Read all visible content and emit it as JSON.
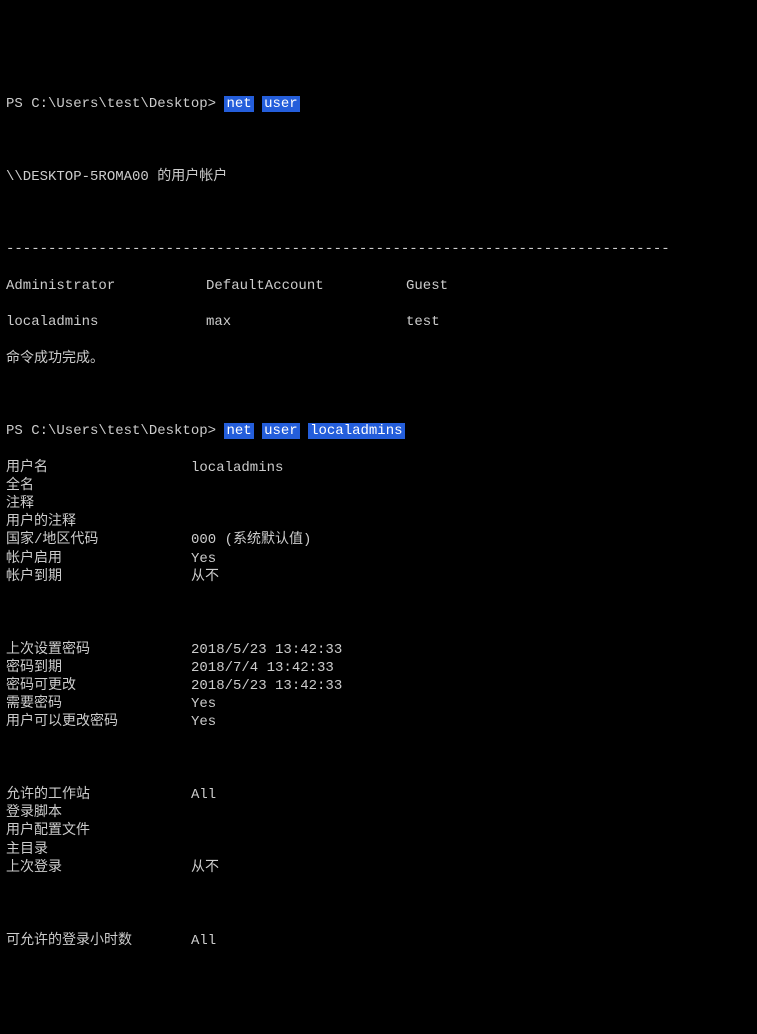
{
  "prompt1": {
    "path": "PS C:\\Users\\test\\Desktop>",
    "cmd_parts": [
      "net",
      "user"
    ]
  },
  "header1": "\\\\DESKTOP-5ROMA00 的用户帐户",
  "separator": "-------------------------------------------------------------------------------",
  "users": {
    "row1": [
      "Administrator",
      "DefaultAccount",
      "Guest"
    ],
    "row2": [
      "localadmins",
      "max",
      "test"
    ]
  },
  "success_msg": "命令成功完成。",
  "prompt2": {
    "path": "PS C:\\Users\\test\\Desktop>",
    "cmd_parts": [
      "net",
      "user",
      "localadmins"
    ]
  },
  "details": [
    {
      "label": "用户名",
      "value": "localadmins"
    },
    {
      "label": "全名",
      "value": ""
    },
    {
      "label": "注释",
      "value": ""
    },
    {
      "label": "用户的注释",
      "value": ""
    },
    {
      "label": "国家/地区代码",
      "value": "000 (系统默认值)"
    },
    {
      "label": "帐户启用",
      "value": "Yes"
    },
    {
      "label": "帐户到期",
      "value": "从不"
    }
  ],
  "details2": [
    {
      "label": "上次设置密码",
      "value": "2018/5/23 13:42:33"
    },
    {
      "label": "密码到期",
      "value": "2018/7/4 13:42:33"
    },
    {
      "label": "密码可更改",
      "value": "2018/5/23 13:42:33"
    },
    {
      "label": "需要密码",
      "value": "Yes"
    },
    {
      "label": "用户可以更改密码",
      "value": "Yes"
    }
  ],
  "details3": [
    {
      "label": "允许的工作站",
      "value": "All"
    },
    {
      "label": "登录脚本",
      "value": ""
    },
    {
      "label": "用户配置文件",
      "value": ""
    },
    {
      "label": "主目录",
      "value": ""
    },
    {
      "label": "上次登录",
      "value": "从不"
    }
  ],
  "details4": [
    {
      "label": "可允许的登录小时数",
      "value": "All"
    }
  ]
}
